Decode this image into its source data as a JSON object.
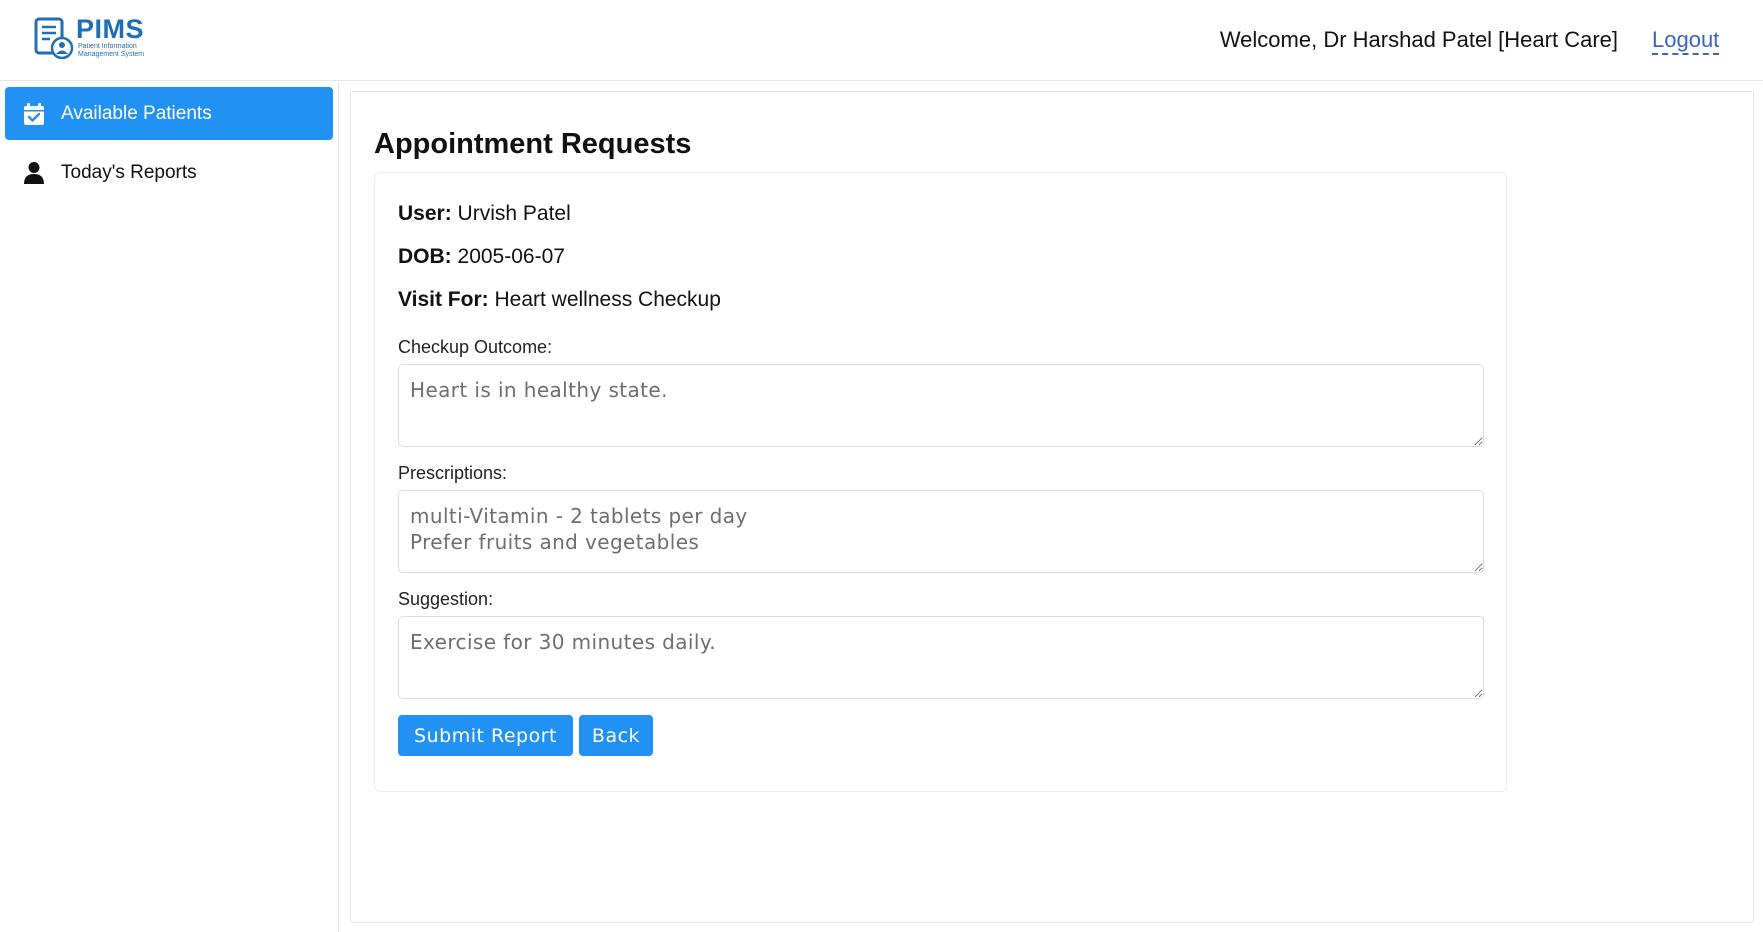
{
  "app": {
    "logo_title": "PIMS",
    "logo_subtitle_line1": "Patient Information",
    "logo_subtitle_line2": "Management System",
    "brand_color": "#1f6fb8"
  },
  "header": {
    "welcome_text": "Welcome, Dr Harshad Patel [Heart Care]",
    "logout_label": "Logout"
  },
  "sidebar": {
    "items": [
      {
        "label": "Available Patients",
        "icon": "calendar-check-icon",
        "active": true
      },
      {
        "label": "Today's Reports",
        "icon": "user-icon",
        "active": false
      }
    ],
    "active_color": "#2191f3"
  },
  "main": {
    "title": "Appointment Requests",
    "patient": {
      "user_label": "User:",
      "user_value": "Urvish Patel",
      "dob_label": "DOB:",
      "dob_value": "2005-06-07",
      "visit_label": "Visit For:",
      "visit_value": "Heart wellness Checkup"
    },
    "form": {
      "outcome_label": "Checkup Outcome:",
      "outcome_value": "Heart is in healthy state.",
      "prescriptions_label": "Prescriptions:",
      "prescriptions_value": "multi-Vitamin - 2 tablets per day\nPrefer fruits and vegetables",
      "suggestion_label": "Suggestion:",
      "suggestion_value": "Exercise for 30 minutes daily.",
      "submit_label": "Submit Report",
      "back_label": "Back"
    }
  }
}
